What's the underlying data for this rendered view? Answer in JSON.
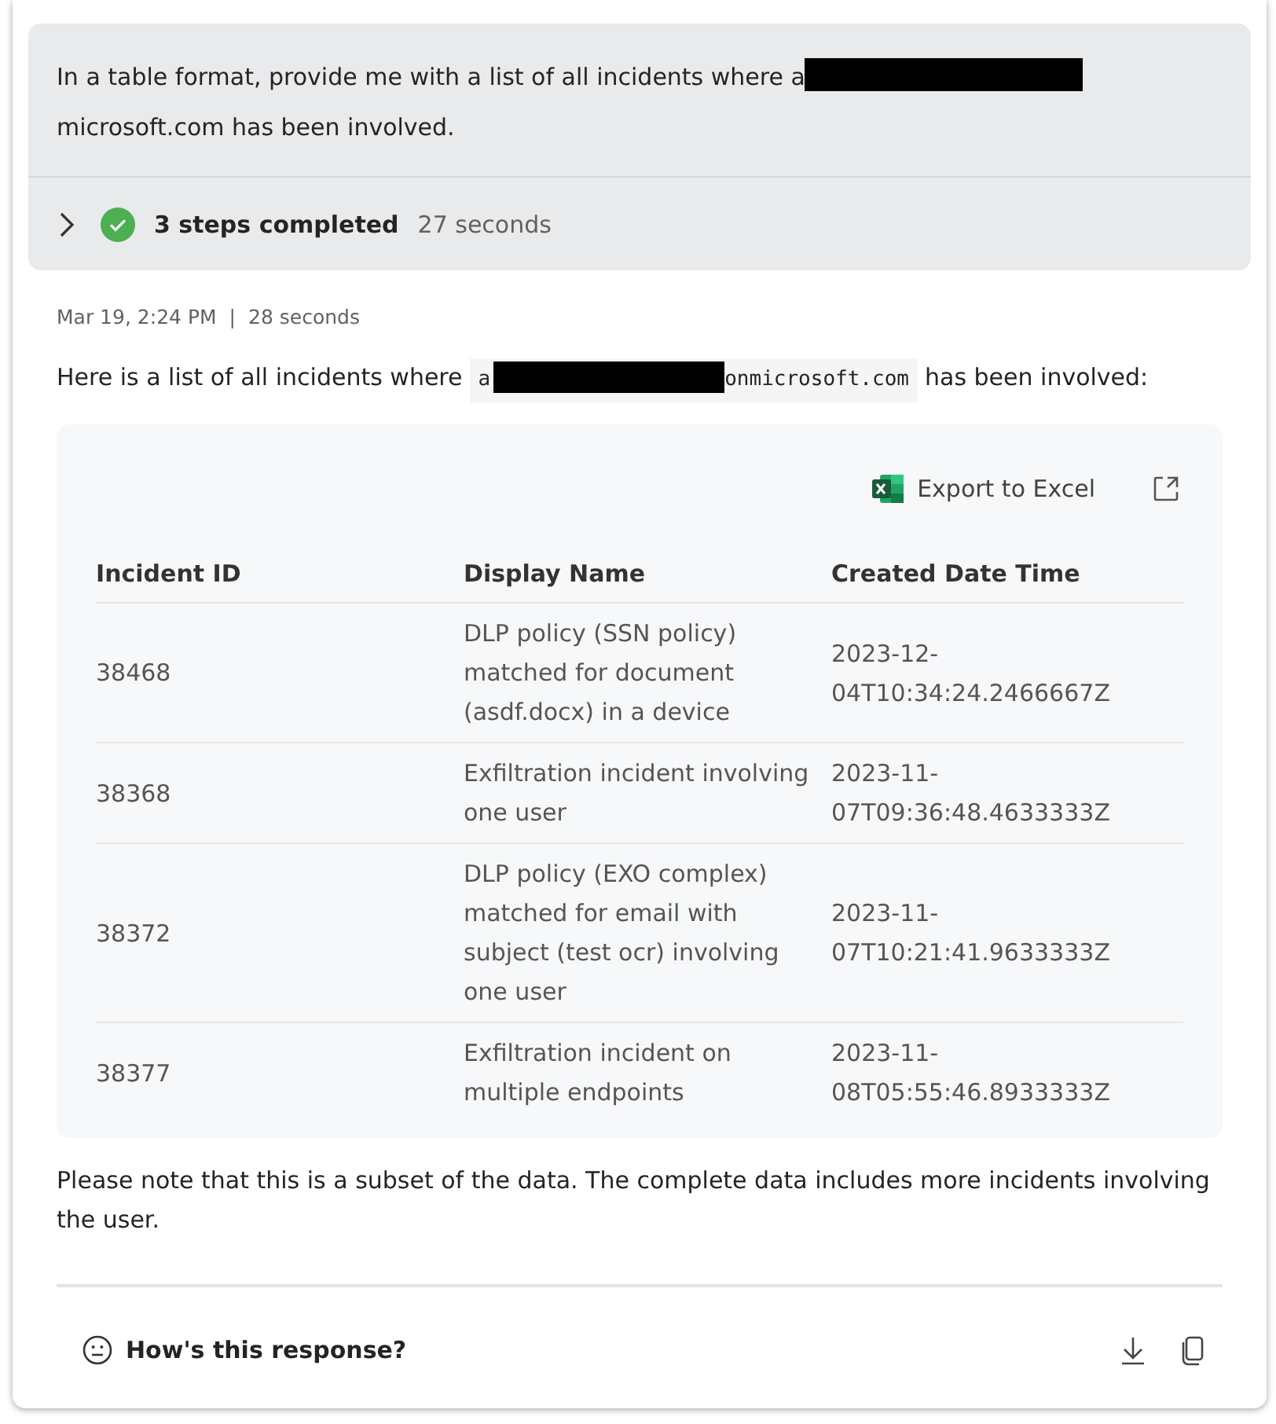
{
  "prompt": {
    "segments": [
      {
        "kind": "text",
        "text": "In a table format, provide me with a list of all incidents where a"
      },
      {
        "kind": "redaction"
      },
      {
        "kind": "text",
        "text": "microsoft.com has been involved."
      }
    ]
  },
  "steps": {
    "expanded": false,
    "label": "3 steps completed",
    "duration": "27 seconds"
  },
  "response": {
    "timestamp": "Mar 19, 2:24 PM",
    "separator": "|",
    "elapsed": "28 seconds",
    "intro": [
      {
        "kind": "text",
        "text": "Here is a list of all incidents where"
      },
      {
        "kind": "code",
        "parts": [
          {
            "kind": "text",
            "text": "a"
          },
          {
            "kind": "redaction"
          },
          {
            "kind": "text",
            "text": "onmicrosoft.com"
          }
        ]
      },
      {
        "kind": "text",
        "text": "has been involved:"
      }
    ],
    "table": {
      "export_label": "Export to Excel",
      "columns": [
        "Incident ID",
        "Display Name",
        "Created Date Time"
      ],
      "rows": [
        [
          "38468",
          "DLP policy (SSN policy) matched for document (asdf.docx) in a device",
          "2023-12-04T10:34:24.2466667Z"
        ],
        [
          "38368",
          "Exfiltration incident involving one user",
          "2023-11-07T09:36:48.4633333Z"
        ],
        [
          "38372",
          "DLP policy (EXO complex) matched for email with subject (test ocr) involving one user",
          "2023-11-07T10:21:41.9633333Z"
        ],
        [
          "38377",
          "Exfiltration incident on multiple endpoints",
          "2023-11-08T05:55:46.8933333Z"
        ]
      ]
    },
    "note": "Please note that this is a subset of the data. The complete data includes more incidents involving the user."
  },
  "feedback": {
    "label": "How's this response?"
  }
}
